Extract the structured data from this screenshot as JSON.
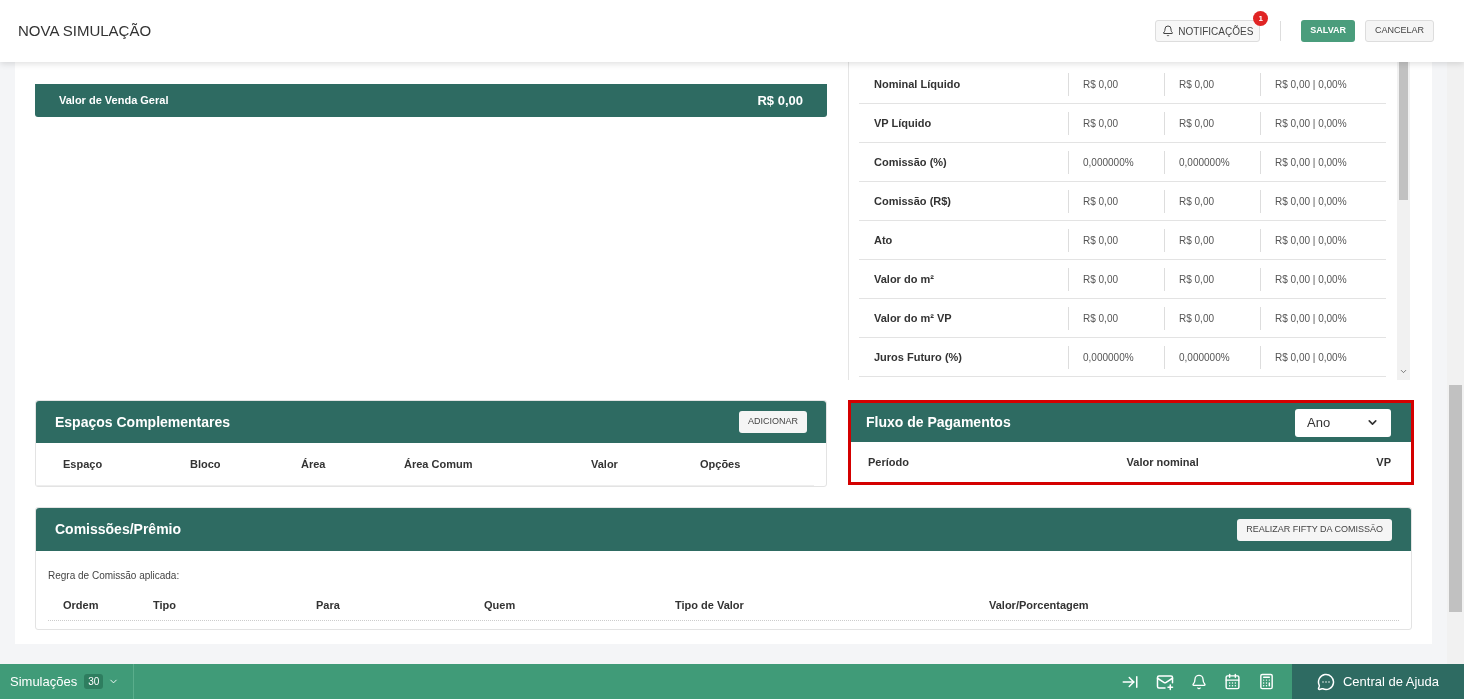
{
  "header": {
    "title": "NOVA SIMULAÇÃO",
    "notifications": {
      "label": "NOTIFICAÇÕES",
      "badge": "1"
    },
    "save": "SALVAR",
    "cancel": "CANCELAR"
  },
  "venda": {
    "label": "Valor de Venda Geral",
    "value": "R$ 0,00"
  },
  "summary_rows": [
    {
      "label": "Nominal Líquido",
      "values": [
        "R$ 0,00",
        "R$ 0,00",
        "R$ 0,00 | 0,00%"
      ]
    },
    {
      "label": "VP Líquido",
      "values": [
        "R$ 0,00",
        "R$ 0,00",
        "R$ 0,00 | 0,00%"
      ]
    },
    {
      "label": "Comissão (%)",
      "values": [
        "0,000000%",
        "0,000000%",
        "R$ 0,00 | 0,00%"
      ]
    },
    {
      "label": "Comissão (R$)",
      "values": [
        "R$ 0,00",
        "R$ 0,00",
        "R$ 0,00 | 0,00%"
      ]
    },
    {
      "label": "Ato",
      "values": [
        "R$ 0,00",
        "R$ 0,00",
        "R$ 0,00 | 0,00%"
      ]
    },
    {
      "label": "Valor do m²",
      "values": [
        "R$ 0,00",
        "R$ 0,00",
        "R$ 0,00 | 0,00%"
      ]
    },
    {
      "label": "Valor do m² VP",
      "values": [
        "R$ 0,00",
        "R$ 0,00",
        "R$ 0,00 | 0,00%"
      ]
    },
    {
      "label": "Juros Futuro (%)",
      "values": [
        "0,000000%",
        "0,000000%",
        "R$ 0,00 | 0,00%"
      ]
    }
  ],
  "espacos": {
    "title": "Espaços Complementares",
    "button": "ADICIONAR",
    "columns": [
      "Espaço",
      "Bloco",
      "Área",
      "Área Comum",
      "Valor",
      "Opções"
    ]
  },
  "fluxo": {
    "title": "Fluxo de Pagamentos",
    "select": "Ano",
    "highlighted": true,
    "columns": [
      "Período",
      "Valor nominal",
      "VP"
    ]
  },
  "comissoes": {
    "title": "Comissões/Prêmio",
    "button": "REALIZAR FIFTY DA COMISSÃO",
    "rule_label": "Regra de Comissão aplicada:",
    "columns": [
      "Ordem",
      "Tipo",
      "Para",
      "Quem",
      "Tipo de Valor",
      "Valor/Porcentagem"
    ]
  },
  "bottom_bar": {
    "simulacoes": "Simulações",
    "count": "30",
    "help": "Central de Ajuda"
  }
}
